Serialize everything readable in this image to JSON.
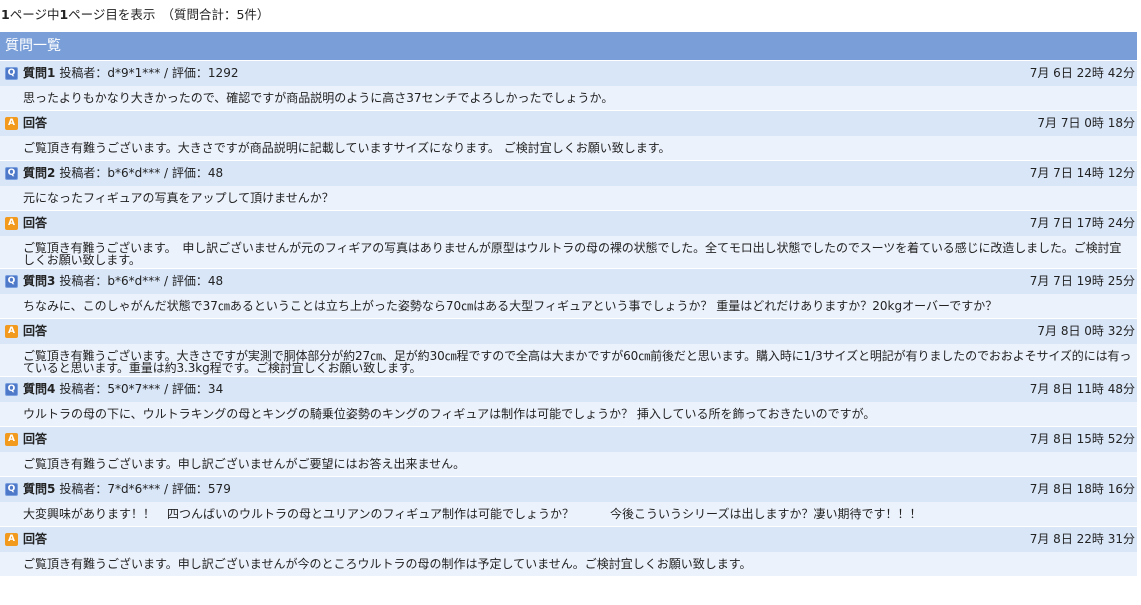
{
  "pagination": {
    "total_pages": "1",
    "middle": "ページ中",
    "current_page": "1",
    "suffix": "ページ目を表示",
    "total": "（質問合計：5件）"
  },
  "list_title": "質問一覧",
  "icons": {
    "question": "Q",
    "answer": "A"
  },
  "colors": {
    "title_bar": "#7a9fd8",
    "head_row": "#d8e6f8",
    "body_row": "#ecf2fc",
    "q_icon": "#4e78c8",
    "a_icon": "#f29a1e"
  },
  "items": [
    {
      "q_label": "質問1",
      "q_meta": "投稿者：d*9*1*** / 評価：1292",
      "q_date": "7月 6日 22時 42分",
      "q_text": "思ったよりもかなり大きかったので、確認ですが商品説明のように高さ37センチでよろしかったでしょうか。",
      "a_label": "回答",
      "a_date": "7月 7日 0時 18分",
      "a_text": "ご覧頂き有難うございます。大きさですが商品説明に記載していますサイズになります。 ご検討宜しくお願い致します。"
    },
    {
      "q_label": "質問2",
      "q_meta": "投稿者：b*6*d*** / 評価：48",
      "q_date": "7月 7日 14時 12分",
      "q_text": "元になったフィギュアの写真をアップして頂けませんか？",
      "a_label": "回答",
      "a_date": "7月 7日 17時 24分",
      "a_text": "ご覧頂き有難うございます。　申し訳ございませんが元のフィギアの写真はありませんが原型はウルトラの母の裸の状態でした。全てモロ出し状態でしたのでスーツを着ている感じに改造しました。ご検討宜しくお願い致します。"
    },
    {
      "q_label": "質問3",
      "q_meta": "投稿者：b*6*d*** / 評価：48",
      "q_date": "7月 7日 19時 25分",
      "q_text": "ちなみに、このしゃがんだ状態で37㎝あるということは立ち上がった姿勢なら70㎝はある大型フィギュアという事でしょうか？ 重量はどれだけありますか？20kgオーバーですか？",
      "a_label": "回答",
      "a_date": "7月 8日 0時 32分",
      "a_text": "ご覧頂き有難うございます。大きさですが実測で胴体部分が約27㎝、足が約30㎝程ですので全高は大まかですが60㎝前後だと思います。購入時に1/3サイズと明記が有りましたのでおおよそサイズ的には有っていると思います。重量は約3.3kg程です。ご検討宜しくお願い致します。"
    },
    {
      "q_label": "質問4",
      "q_meta": "投稿者：5*0*7*** / 評価：34",
      "q_date": "7月 8日 11時 48分",
      "q_text": "ウルトラの母の下に、ウルトラキングの母とキングの騎乗位姿勢のキングのフィギュアは制作は可能でしょうか？ 挿入している所を飾っておきたいのですが。",
      "a_label": "回答",
      "a_date": "7月 8日 15時 52分",
      "a_text": "ご覧頂き有難うございます。申し訳ございませんがご要望にはお答え出来ません。"
    },
    {
      "q_label": "質問5",
      "q_meta": "投稿者：7*d*6*** / 評価：579",
      "q_date": "7月 8日 18時 16分",
      "q_text": "大変興味があります！！　四つんばいのウルトラの母とユリアンのフィギュア制作は可能でしょうか？　　　今後こういうシリーズは出しますか？凄い期待です！！！",
      "a_label": "回答",
      "a_date": "7月 8日 22時 31分",
      "a_text": "ご覧頂き有難うございます。申し訳ございませんが今のところウルトラの母の制作は予定していません。ご検討宜しくお願い致します。"
    }
  ]
}
